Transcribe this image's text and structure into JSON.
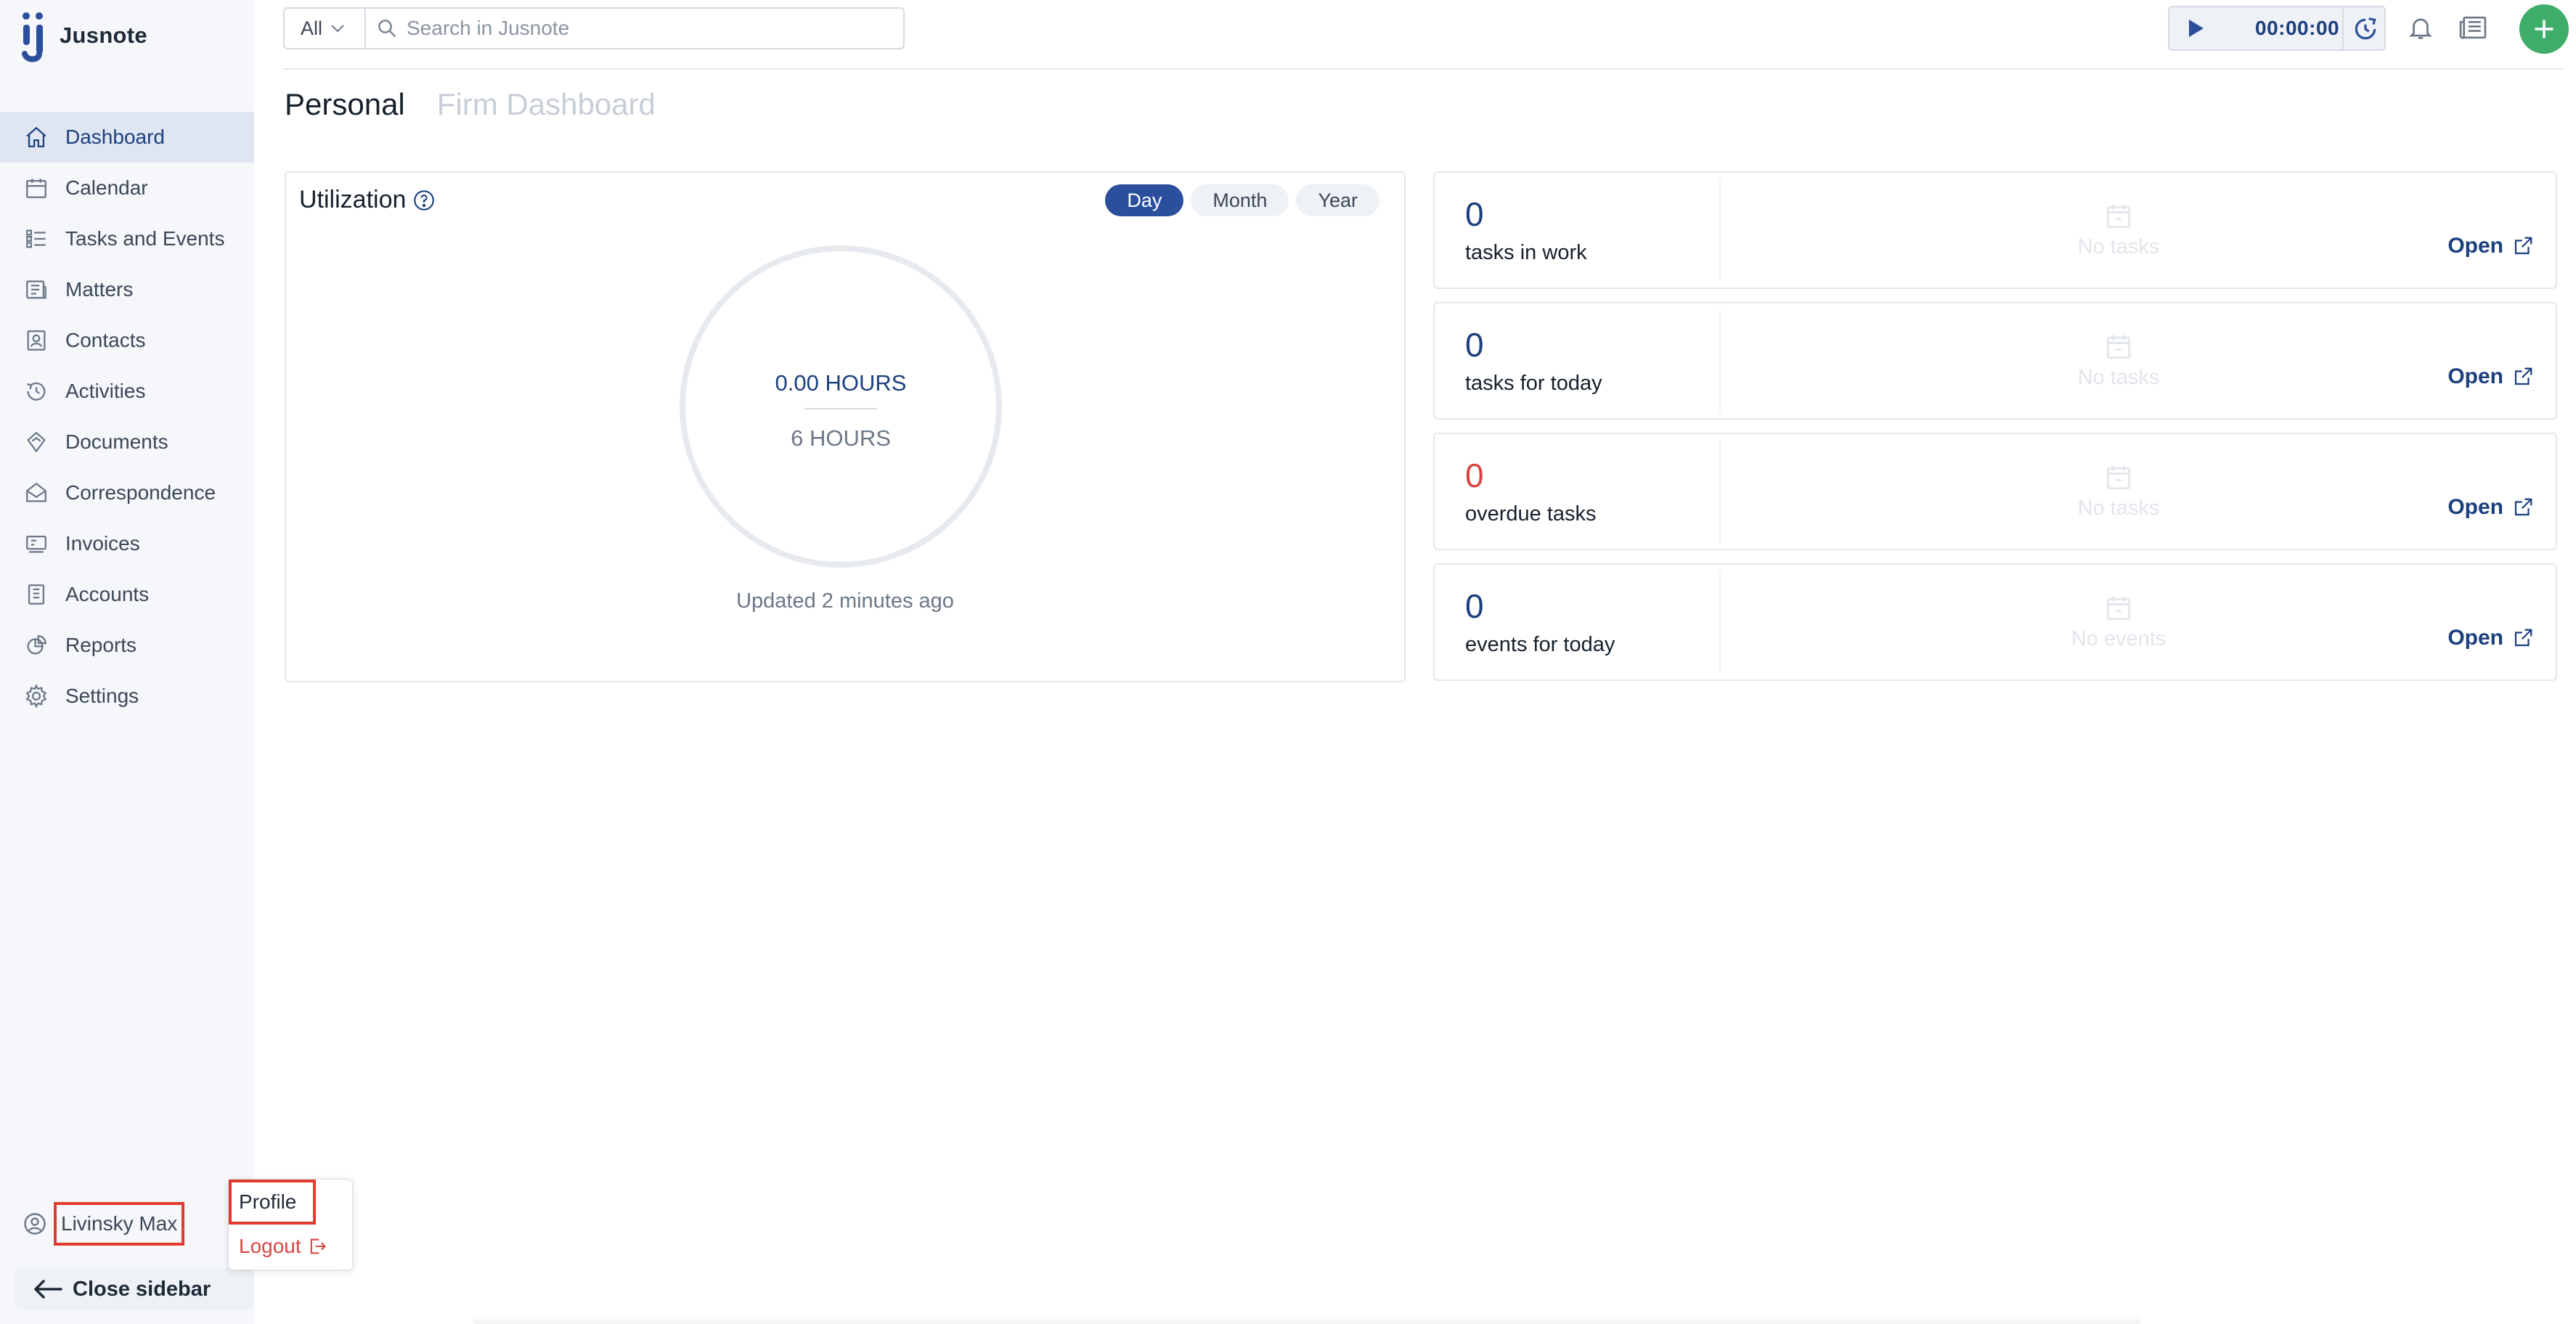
{
  "app": {
    "name": "Jusnote"
  },
  "sidebar": {
    "items": [
      {
        "label": "Dashboard",
        "icon": "home-icon",
        "active": true
      },
      {
        "label": "Calendar",
        "icon": "calendar-icon"
      },
      {
        "label": "Tasks and Events",
        "icon": "tasks-icon"
      },
      {
        "label": "Matters",
        "icon": "briefcase-icon"
      },
      {
        "label": "Contacts",
        "icon": "contacts-icon"
      },
      {
        "label": "Activities",
        "icon": "activity-icon"
      },
      {
        "label": "Documents",
        "icon": "documents-icon"
      },
      {
        "label": "Correspondence",
        "icon": "mail-icon"
      },
      {
        "label": "Invoices",
        "icon": "invoice-icon"
      },
      {
        "label": "Accounts",
        "icon": "bank-icon"
      },
      {
        "label": "Reports",
        "icon": "reports-icon"
      },
      {
        "label": "Settings",
        "icon": "gear-icon"
      }
    ],
    "user_name": "Livinsky Max",
    "close_label": "Close sidebar"
  },
  "user_menu": {
    "profile": "Profile",
    "logout": "Logout"
  },
  "header": {
    "filter_value": "All",
    "search_placeholder": "Search in Jusnote",
    "timer": "00:00:00"
  },
  "tabs": [
    {
      "label": "Personal",
      "active": true
    },
    {
      "label": "Firm Dashboard",
      "active": false
    }
  ],
  "utilization": {
    "title": "Utilization",
    "periods": [
      "Day",
      "Month",
      "Year"
    ],
    "selected_period": "Day",
    "logged": "0.00 HOURS",
    "target": "6 HOURS",
    "updated": "Updated 2 minutes ago"
  },
  "stats": [
    {
      "value": "0",
      "label": "tasks in work",
      "empty": "No tasks",
      "link": "Open"
    },
    {
      "value": "0",
      "label": "tasks for today",
      "empty": "No tasks",
      "link": "Open"
    },
    {
      "value": "0",
      "label": "overdue tasks",
      "empty": "No tasks",
      "link": "Open"
    },
    {
      "value": "0",
      "label": "events for today",
      "empty": "No events",
      "link": "Open"
    }
  ],
  "colors": {
    "accent": "#1c3f7e",
    "danger": "#d64541",
    "add_button": "#3ead6a",
    "highlight": "#e23b2e"
  }
}
